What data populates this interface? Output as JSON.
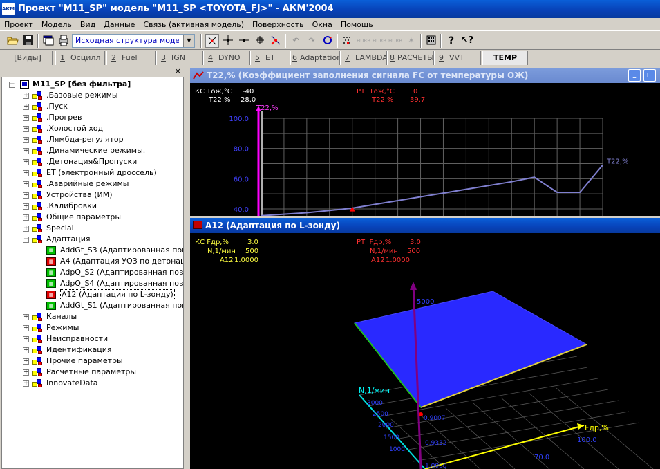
{
  "app": {
    "title": "Проект \"M11_SP\" модель \"M11_SP <TOYOTA_FJ>\" - АКМ'2004",
    "icon_label": "АКМ"
  },
  "menu": [
    "Проект",
    "Модель",
    "Вид",
    "Данные",
    "Связь (активная модель)",
    "Поверхность",
    "Окна",
    "Помощь"
  ],
  "toolbar": {
    "combo_value": "Исходная структура модели 'M",
    "icons": [
      "open-icon",
      "save-icon",
      "windows-icon",
      "print-icon",
      "cursor-icon",
      "point-icon",
      "move-icon",
      "grid-icon",
      "select-icon",
      "undo-icon",
      "redo-icon",
      "refresh-icon",
      "smooth-icon",
      "smooth2-icon",
      "smooth3-icon",
      "smooth4-icon",
      "wand-icon",
      "calc-icon",
      "help-icon",
      "context-help-icon"
    ]
  },
  "tabs": [
    {
      "num": "",
      "label": "[Виды]"
    },
    {
      "num": "1",
      "label": "Осцилл"
    },
    {
      "num": "2",
      "label": "Fuel"
    },
    {
      "num": "3",
      "label": "IGN"
    },
    {
      "num": "4",
      "label": "DYNO"
    },
    {
      "num": "5",
      "label": "ET"
    },
    {
      "num": "6",
      "label": "Adaptation"
    },
    {
      "num": "7",
      "label": "LAMBDA"
    },
    {
      "num": "8",
      "label": "РАСЧЕТЫ"
    },
    {
      "num": "9",
      "label": "VVT"
    },
    {
      "num": "",
      "label": "TEMP"
    }
  ],
  "panel": {
    "close_label": "×"
  },
  "tree": {
    "root": "M11_SP [без фильтра]",
    "groups": [
      ".Базовые режимы",
      ".Пуск",
      ".Прогрев",
      ".Холостой ход",
      ".Лямбда-регулятор",
      ".Динамические режимы.",
      ".Детонация&Пропуски",
      "ET (электронный дроссель)",
      ".Аварийные режимы",
      "Устройства (ИМ)",
      ".Калибровки",
      "Общие параметры",
      "Special",
      "Адаптация"
    ],
    "children": [
      {
        "label": "AddGt_S3 (Адаптированная пов-ть",
        "state": "green"
      },
      {
        "label": "A4 (Адаптация УОЗ по детонации",
        "state": "red"
      },
      {
        "label": "AdpQ_S2 (Адаптированная пов-ть",
        "state": "green"
      },
      {
        "label": "AdpQ_S4 (Адаптированная пов-ть",
        "state": "green"
      },
      {
        "label": "A12 (Адаптация по L-зонду)",
        "state": "red",
        "selected": true
      },
      {
        "label": "AddGt_S1 (Адаптированная пов-ть",
        "state": "green"
      }
    ],
    "groups_after": [
      "Каналы",
      "Режимы",
      "Неисправности",
      "Идентификация",
      "Прочие параметры",
      "Расчетные параметры",
      "InnovateData"
    ]
  },
  "win1": {
    "title": "T22,% (Коэффициент заполнения сигнала FC от температуры ОЖ)",
    "kc": {
      "label": "КС",
      "p1_name": "Тож,°С",
      "p1_value": "-40",
      "p2_name": "T22,%",
      "p2_value": "28.0"
    },
    "pt": {
      "label": "РТ",
      "p1_name": "Тож,°С",
      "p1_value": "0",
      "p2_name": "T22,%",
      "p2_value": "39.7"
    }
  },
  "win2": {
    "title": "A12 (Адаптация по L-зонду)",
    "kc": {
      "label": "КС",
      "p1_name": "Fдр,%",
      "p1_value": "3.0",
      "p2_name": "N,1/мин",
      "p2_value": "500",
      "p3_name": "A12",
      "p3_value": "1.0000"
    },
    "pt": {
      "label": "РТ",
      "p1_name": "Fдр,%",
      "p1_value": "3.0",
      "p2_name": "N,1/мин",
      "p2_value": "500",
      "p3_name": "A12",
      "p3_value": "1.0000"
    },
    "axis_z_value": "5000",
    "axis_x_label": "Fдр,%",
    "axis_x_ticks": [
      "100.0",
      "70.0"
    ],
    "axis_y_label": "N,1/мин",
    "axis_y_ticks": [
      "3000",
      "2500",
      "2000",
      "1500",
      "1000"
    ],
    "axis_z_ticks": [
      "0.9007",
      "0.9332",
      "1.0000"
    ]
  },
  "colors": {
    "surface": "#2929ff",
    "line_chart": "#8080d0",
    "marker": "#ff0000",
    "axis_magenta": "#ff00ff",
    "axis_yellow": "#ffff00",
    "axis_cyan": "#00ffff",
    "grid": "#606060"
  },
  "chart_data": {
    "type": "line",
    "title": "",
    "ylabel": "T22,%",
    "series": [
      {
        "name": "T22,%",
        "x": [
          0,
          1,
          2,
          3,
          4,
          5,
          6,
          7,
          8,
          9,
          10,
          11,
          12,
          13,
          14,
          15
        ],
        "values": [
          35.5,
          36.5,
          37.5,
          39.0,
          40.5,
          43.0,
          45.5,
          48.0,
          50.5,
          53.0,
          55.5,
          58.0,
          61.0,
          51.0,
          51.0,
          69.0
        ]
      }
    ],
    "y_ticks": [
      "100.0",
      "80.0",
      "60.0",
      "40.0"
    ],
    "ylim": [
      35.5,
      100
    ],
    "grid": true,
    "current_point": {
      "x": 4,
      "y": 39.7
    }
  }
}
